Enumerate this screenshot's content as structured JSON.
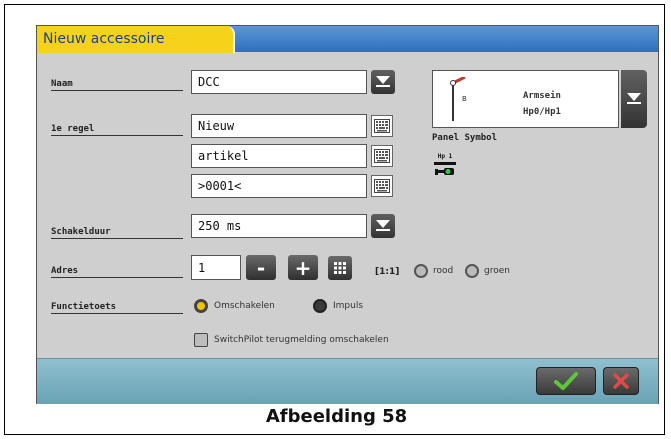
{
  "window": {
    "tab_title": "Nieuw accessoire"
  },
  "form": {
    "naam": {
      "label": "Naam",
      "value": "DCC"
    },
    "eerste_regel": {
      "label": "1e regel",
      "value": "Nieuw"
    },
    "tweede_regel": {
      "value": "artikel"
    },
    "derde_regel": {
      "value": ">0001<"
    },
    "schakelduur": {
      "label": "Schakelduur",
      "value": "250 ms"
    },
    "adres": {
      "label": "Adres",
      "value": "1",
      "minus": "-",
      "plus": "+",
      "ratio": "[1:1]"
    },
    "functietoets": {
      "label": "Functietoets"
    }
  },
  "outputs": {
    "rood": "rood",
    "groen": "groen"
  },
  "modes": {
    "omschakelen": "Omschakelen",
    "impuls": "Impuls",
    "selected": "omschakelen"
  },
  "switchpilot": {
    "label": "SwitchPilot terugmelding omschakelen",
    "checked": false
  },
  "symbol": {
    "name": "Armsein",
    "type": "Hp0/Hp1",
    "panel_label": "Panel Symbol",
    "panel_code": "Hp 1"
  },
  "caption": "Afbeelding 58",
  "colors": {
    "tab": "#f6d31a",
    "titlebar": "#2d6fbf",
    "footer": "#7fb3c4",
    "ok": "#5cc83a",
    "cancel": "#e04a4a",
    "radio_selected": "#f2c300"
  }
}
